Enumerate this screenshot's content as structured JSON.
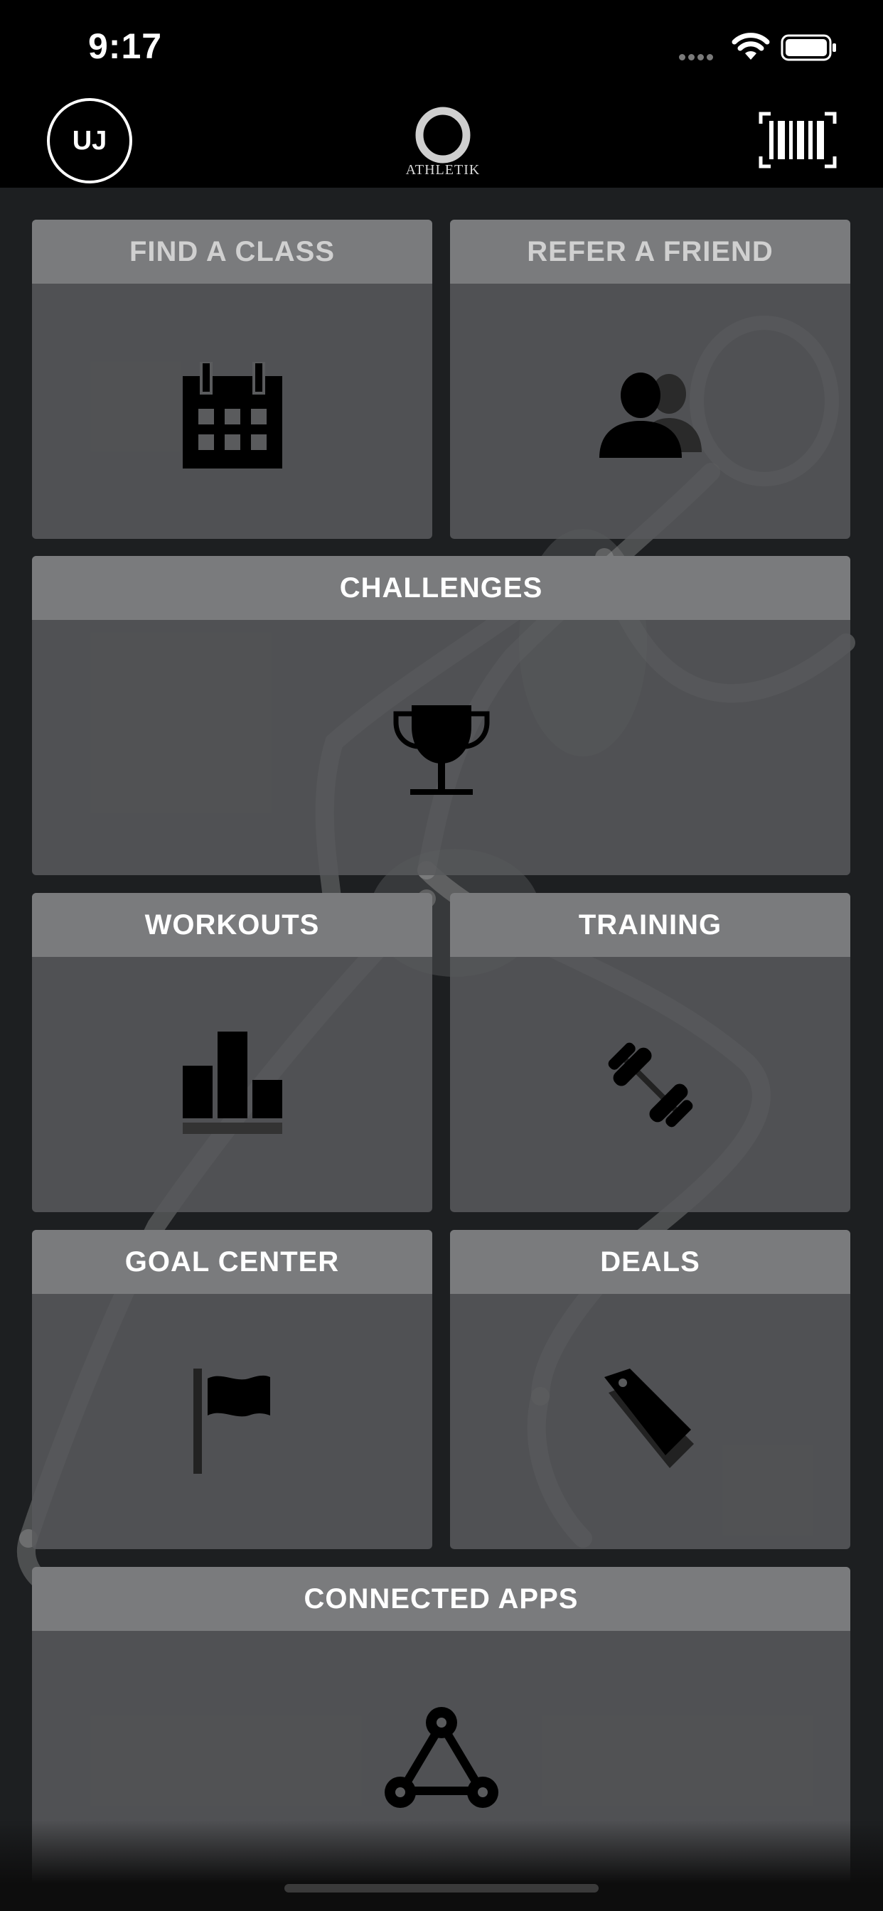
{
  "status_bar": {
    "time": "9:17"
  },
  "header": {
    "avatar_initials": "UJ",
    "logo_text": "ATHLETIK"
  },
  "tiles": [
    {
      "label": "FIND A CLASS",
      "icon": "calendar-icon"
    },
    {
      "label": "REFER A FRIEND",
      "icon": "users-icon"
    },
    {
      "label": "CHALLENGES",
      "icon": "trophy-icon"
    },
    {
      "label": "WORKOUTS",
      "icon": "bar-chart-icon"
    },
    {
      "label": "TRAINING",
      "icon": "dumbbell-icon"
    },
    {
      "label": "GOAL CENTER",
      "icon": "flag-icon"
    },
    {
      "label": "DEALS",
      "icon": "tag-icon"
    },
    {
      "label": "CONNECTED APPS",
      "icon": "connected-nodes-icon"
    }
  ],
  "colors": {
    "background": "#1d1f21",
    "tile": "#58595b",
    "tile_header": "#7a7b7d",
    "icon": "#000000"
  }
}
